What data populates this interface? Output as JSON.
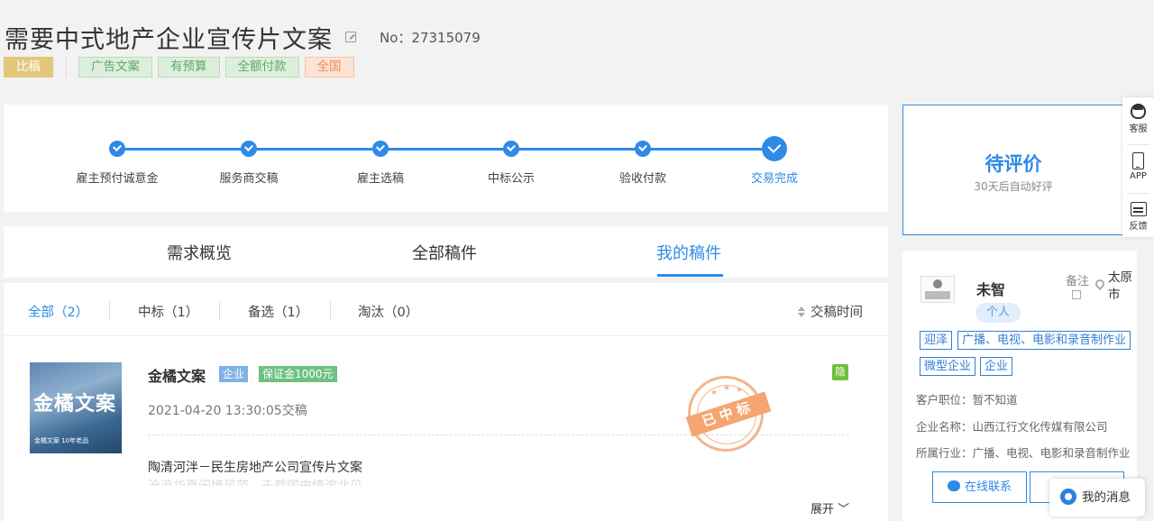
{
  "task": {
    "title": "需要中式地产企业宣传片文案",
    "number": "No：27315079",
    "tags": [
      {
        "text": "比稿",
        "style": "bid"
      },
      {
        "text": "广告文案",
        "style": "green"
      },
      {
        "text": "有预算",
        "style": "green"
      },
      {
        "text": "全额付款",
        "style": "green"
      },
      {
        "text": "全国",
        "style": "orange"
      }
    ]
  },
  "progress": {
    "steps": [
      "雇主预付诚意金",
      "服务商交稿",
      "雇主选稿",
      "中标公示",
      "验收付款",
      "交易完成"
    ],
    "current_step": 6
  },
  "tabs": [
    "需求概览",
    "全部稿件",
    "我的稿件"
  ],
  "active_tab": "我的稿件",
  "filters": {
    "items": [
      "全部（2）",
      "中标（1）",
      "备选（1）",
      "淘汰（0）"
    ],
    "active": "全部（2）",
    "sort_label": "交稿时间"
  },
  "submission": {
    "name": "金橘文案",
    "badge_type": "企业",
    "badge_deposit": "保证金1000元",
    "time": "2021-04-20 13:30:05交稿",
    "hidden_badge": "隐",
    "stamp_text": "已中标",
    "thumb_title": "金橘文案",
    "thumb_caption": "金橘文案 10年老品",
    "desc_line1": "陶清河泮－民生房地产公司宣传片文案",
    "desc_line2": "沧浪华夏闲境风范，千载国史情溶北见",
    "expand_label": "展开 ﹀"
  },
  "evaluation": {
    "status": "待评价",
    "sub": "30天后自动好评"
  },
  "employer": {
    "name": "未智",
    "type": "个人",
    "note_label": "备注",
    "location": "太原市",
    "industry_tags": [
      "迎泽",
      "广播、电视、电影和录音制作业",
      "微型企业",
      "企业"
    ],
    "position_label": "客户职位：",
    "position_value": "暂不知道",
    "company_label": "企业名称：",
    "company_value": "山西江行文化传媒有限公司",
    "industry_label": "所属行业：",
    "industry_value": "广播、电视、电影和录音制作业",
    "contact_button": "在线联系"
  },
  "sidebar": {
    "items": [
      "客服",
      "APP",
      "反馈"
    ]
  },
  "message_button": "我的消息",
  "colors": {
    "accent": "#2f8ae6",
    "bid_tag": "#e3c77a",
    "stamp": "#f4a572"
  }
}
